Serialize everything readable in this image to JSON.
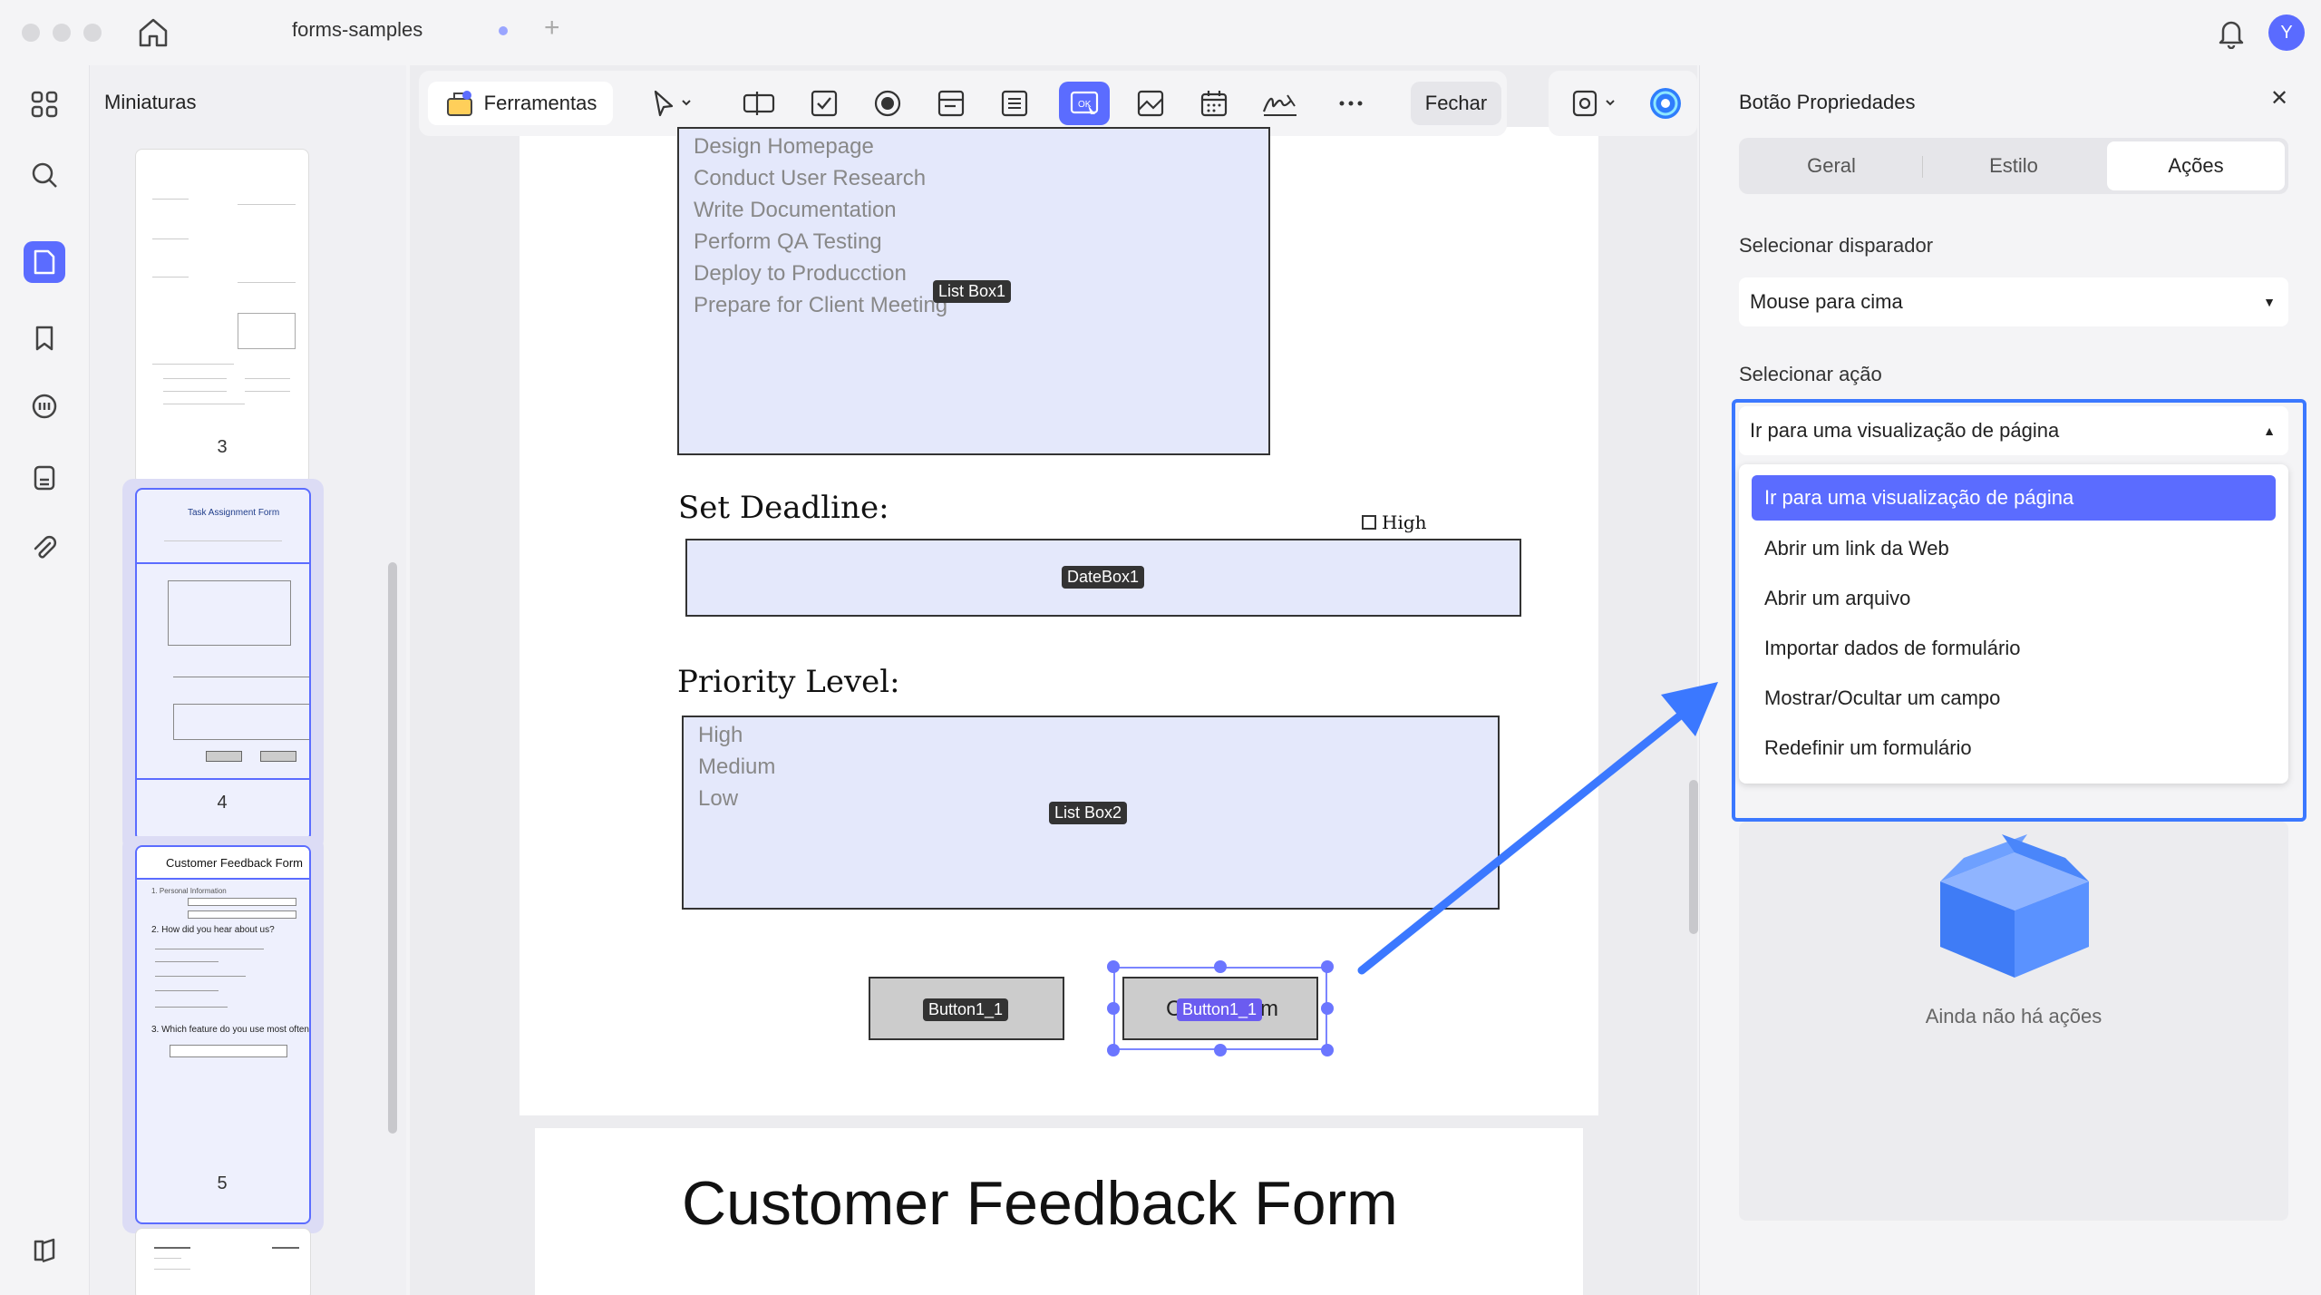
{
  "window": {
    "tab_title": "forms-samples",
    "avatar_letter": "Y"
  },
  "thumbnails": {
    "title": "Miniaturas",
    "pages": [
      {
        "number": "3"
      },
      {
        "number": "4",
        "title": "Task Assignment Form"
      },
      {
        "number": "5",
        "title": "Customer Feedback Form",
        "lines": [
          "1. Personal Information",
          "2. How did you hear about us?",
          "3. Which feature do you use most often?"
        ]
      }
    ]
  },
  "toolbar": {
    "tools_label": "Ferramentas",
    "close_label": "Fechar"
  },
  "document": {
    "listbox1": {
      "items": [
        "Design Homepage",
        "Conduct User Research",
        "Write Documentation",
        "Perform QA Testing",
        "Deploy to Producction",
        "Prepare for Client Meeting"
      ],
      "tag": "List Box1"
    },
    "set_deadline": "Set Deadline:",
    "high_checkbox": "High",
    "datebox_tag": "DateBox1",
    "priority_level": "Priority Level:",
    "listbox2": {
      "items": [
        "High",
        "Medium",
        "Low"
      ],
      "tag": "List Box2"
    },
    "button1_tag": "Button1_1",
    "button2_text": "C",
    "button2_text_end": "m",
    "button2_tag": "Button1_1",
    "next_page_title": "Customer Feedback Form"
  },
  "panel": {
    "title": "Botão Propriedades",
    "tabs": [
      "Geral",
      "Estilo",
      "Ações"
    ],
    "active_tab": "Ações",
    "trigger_label": "Selecionar disparador",
    "trigger_value": "Mouse para cima",
    "action_label": "Selecionar ação",
    "action_value": "Ir para uma visualização de página",
    "action_options": [
      "Ir para uma visualização de página",
      "Abrir um link da Web",
      "Abrir um arquivo",
      "Importar dados de formulário",
      "Mostrar/Ocultar um campo",
      "Redefinir um formulário"
    ],
    "empty_text": "Ainda não há ações"
  },
  "colors": {
    "accent": "#5b6cff",
    "highlight": "#3b78ff",
    "field_fill": "#e4e8fb"
  }
}
